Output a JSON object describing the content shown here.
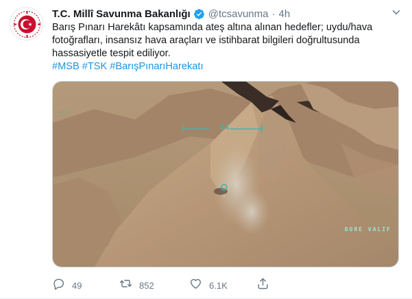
{
  "tweet": {
    "display_name": "T.C. Millî Savunma Bakanlığı",
    "handle": "@tcsavunma",
    "separator": "·",
    "time": "4h",
    "text_lines": [
      "Barış Pınarı Harekâtı kapsamında ateş altına alınan hedefler; uydu/hava",
      "fotoğrafları, insansız hava araçları ve istihbarat bilgileri doğrultusunda",
      "hassasiyetle tespit ediliyor."
    ],
    "hashtags": [
      "#MSB",
      "#TSK",
      "#BarışPınarıHarekatı"
    ]
  },
  "media": {
    "hud_number": "94",
    "hud_corner": "—•—",
    "hud_watermark": "BORE VALIF"
  },
  "actions": {
    "reply_count": "49",
    "retweet_count": "852",
    "like_count": "6.1K"
  },
  "icons": {
    "verified": "verified-badge-icon",
    "caret": "chevron-down-icon",
    "reply": "reply-icon",
    "retweet": "retweet-icon",
    "like": "heart-icon",
    "share": "share-icon"
  },
  "colors": {
    "verified_blue": "#1da1f2",
    "hashtag_blue": "#1b95e0",
    "muted_gray": "#657786",
    "brand_red": "#c8102e"
  }
}
